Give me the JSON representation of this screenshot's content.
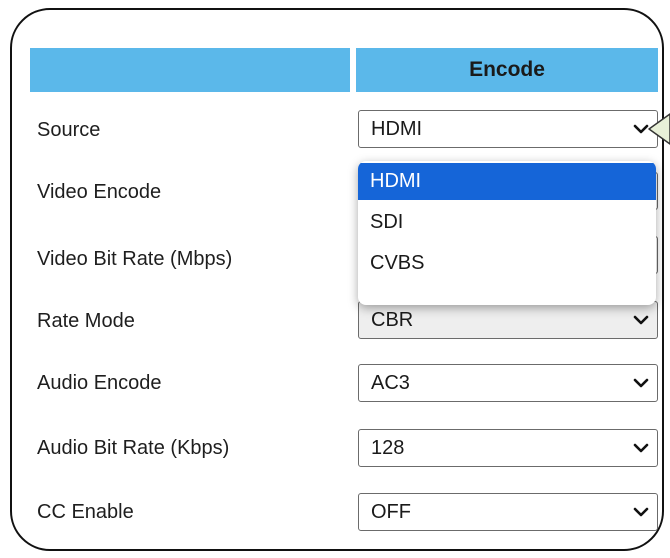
{
  "table": {
    "header_left": "",
    "header_right": "Encode"
  },
  "rows": [
    {
      "label": "Source",
      "value": "HDMI"
    },
    {
      "label": "Video Encode",
      "value": ""
    },
    {
      "label": "Video Bit Rate (Mbps)",
      "value": ""
    },
    {
      "label": "Rate Mode",
      "value": "CBR"
    },
    {
      "label": "Audio Encode",
      "value": "AC3"
    },
    {
      "label": "Audio Bit Rate (Kbps)",
      "value": "128"
    },
    {
      "label": "CC Enable",
      "value": "OFF"
    }
  ],
  "source_dropdown": {
    "selected": "HDMI",
    "options": [
      "HDMI",
      "SDI",
      "CVBS"
    ]
  },
  "icons": {
    "select_arrow": "chevron-down-icon",
    "callout": "callout-pointer-icon"
  },
  "colors": {
    "header_bg": "#5bb8ea",
    "option_highlight": "#1565d8",
    "callout_fill": "#e8f0d8"
  }
}
